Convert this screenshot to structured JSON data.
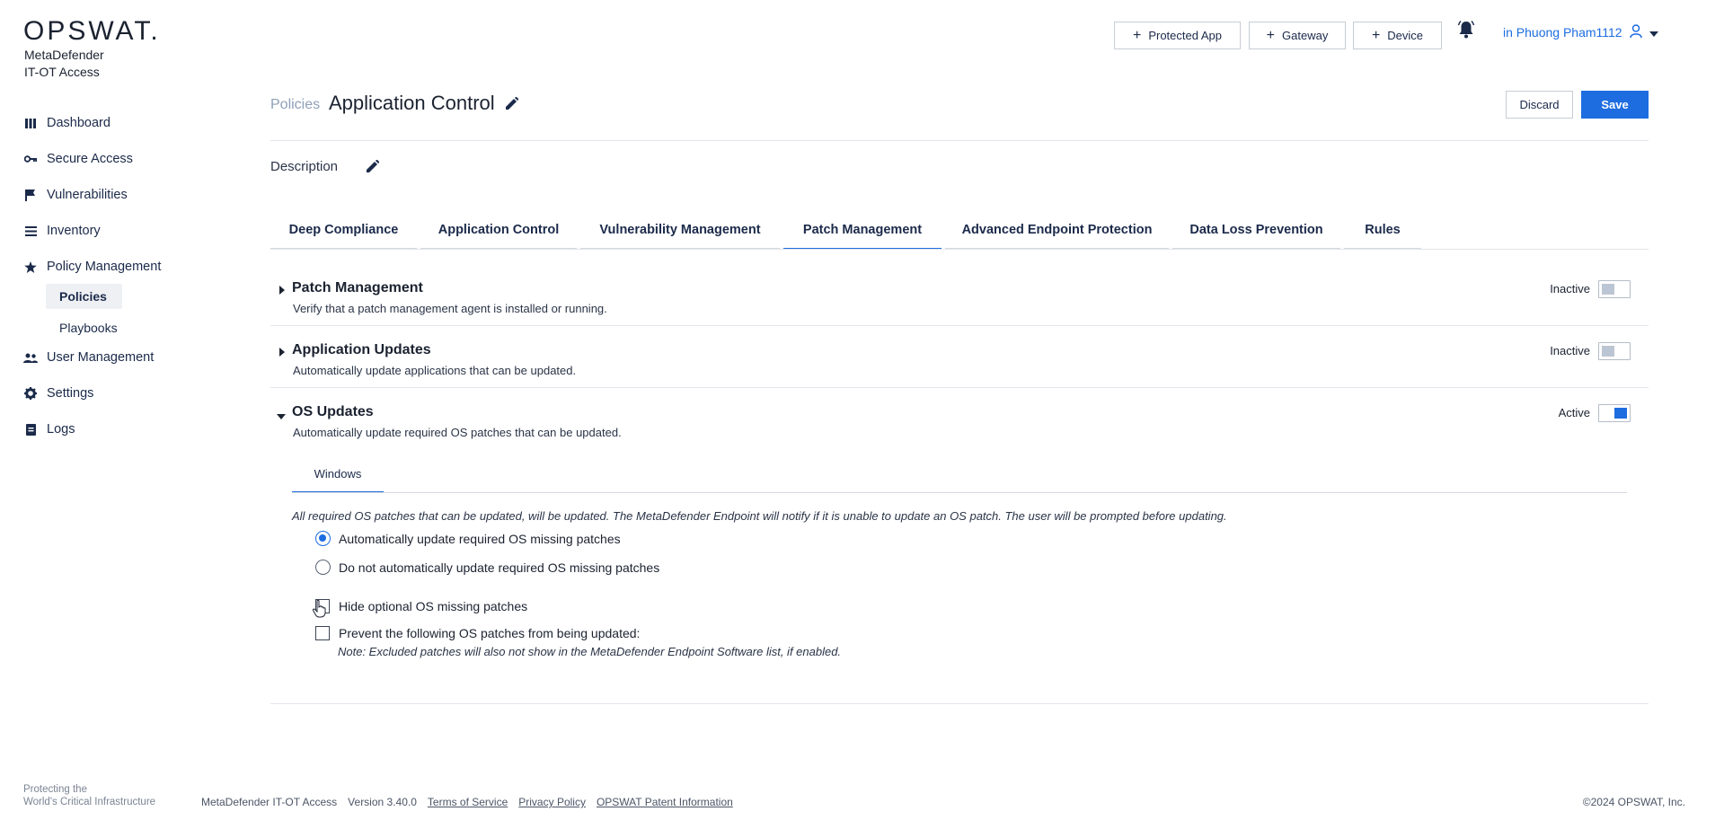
{
  "brand": {
    "logo": "OPSWAT.",
    "product_line1": "MetaDefender",
    "product_line2": "IT-OT Access"
  },
  "sidebar": {
    "items": [
      {
        "label": "Dashboard",
        "icon": "dashboard-icon"
      },
      {
        "label": "Secure Access",
        "icon": "key-icon"
      },
      {
        "label": "Vulnerabilities",
        "icon": "flag-icon"
      },
      {
        "label": "Inventory",
        "icon": "list-icon"
      },
      {
        "label": "Policy Management",
        "icon": "star-icon"
      }
    ],
    "sub_items": [
      {
        "label": "Policies",
        "active": true
      },
      {
        "label": "Playbooks",
        "active": false
      }
    ],
    "items_after": [
      {
        "label": "User Management",
        "icon": "users-icon"
      },
      {
        "label": "Settings",
        "icon": "gear-icon"
      },
      {
        "label": "Logs",
        "icon": "log-icon"
      }
    ]
  },
  "header": {
    "buttons": [
      "Protected App",
      "Gateway",
      "Device"
    ],
    "user_label": "in Phuong Pham1112"
  },
  "page": {
    "breadcrumb": "Policies",
    "title": "Application Control",
    "discard_label": "Discard",
    "save_label": "Save",
    "description_label": "Description"
  },
  "tabs": [
    {
      "label": "Deep Compliance",
      "active": false
    },
    {
      "label": "Application Control",
      "active": false
    },
    {
      "label": "Vulnerability Management",
      "active": false
    },
    {
      "label": "Patch Management",
      "active": true
    },
    {
      "label": "Advanced Endpoint Protection",
      "active": false
    },
    {
      "label": "Data Loss Prevention",
      "active": false
    },
    {
      "label": "Rules",
      "active": false
    }
  ],
  "sections": [
    {
      "title": "Patch Management",
      "desc": "Verify that a patch management agent is installed or running.",
      "status": "Inactive",
      "expanded": false
    },
    {
      "title": "Application Updates",
      "desc": "Automatically update applications that can be updated.",
      "status": "Inactive",
      "expanded": false
    },
    {
      "title": "OS Updates",
      "desc": "Automatically update required OS patches that can be updated.",
      "status": "Active",
      "expanded": true
    }
  ],
  "os_updates": {
    "subtab": "Windows",
    "note": "All required OS patches that can be updated, will be updated. The MetaDefender Endpoint will notify if it is unable to update an OS patch. The user will be prompted before updating.",
    "radio_auto": "Automatically update required OS missing patches",
    "radio_none": "Do not automatically update required OS missing patches",
    "check_hide": "Hide optional OS missing patches",
    "check_prevent": "Prevent the following OS patches from being updated:",
    "prevent_note": "Note: Excluded patches will also not show in the MetaDefender Endpoint Software list, if enabled."
  },
  "footer": {
    "tagline1": "Protecting the",
    "tagline2": "World's Critical Infrastructure",
    "product": "MetaDefender IT-OT Access",
    "version": "Version 3.40.0",
    "terms": "Terms of Service",
    "privacy": "Privacy Policy",
    "patent": "OPSWAT Patent Information",
    "copyright": "©2024 OPSWAT, Inc."
  },
  "colors": {
    "accent": "#1d6de0",
    "text": "#1b2230",
    "muted": "#8fa0b8"
  }
}
